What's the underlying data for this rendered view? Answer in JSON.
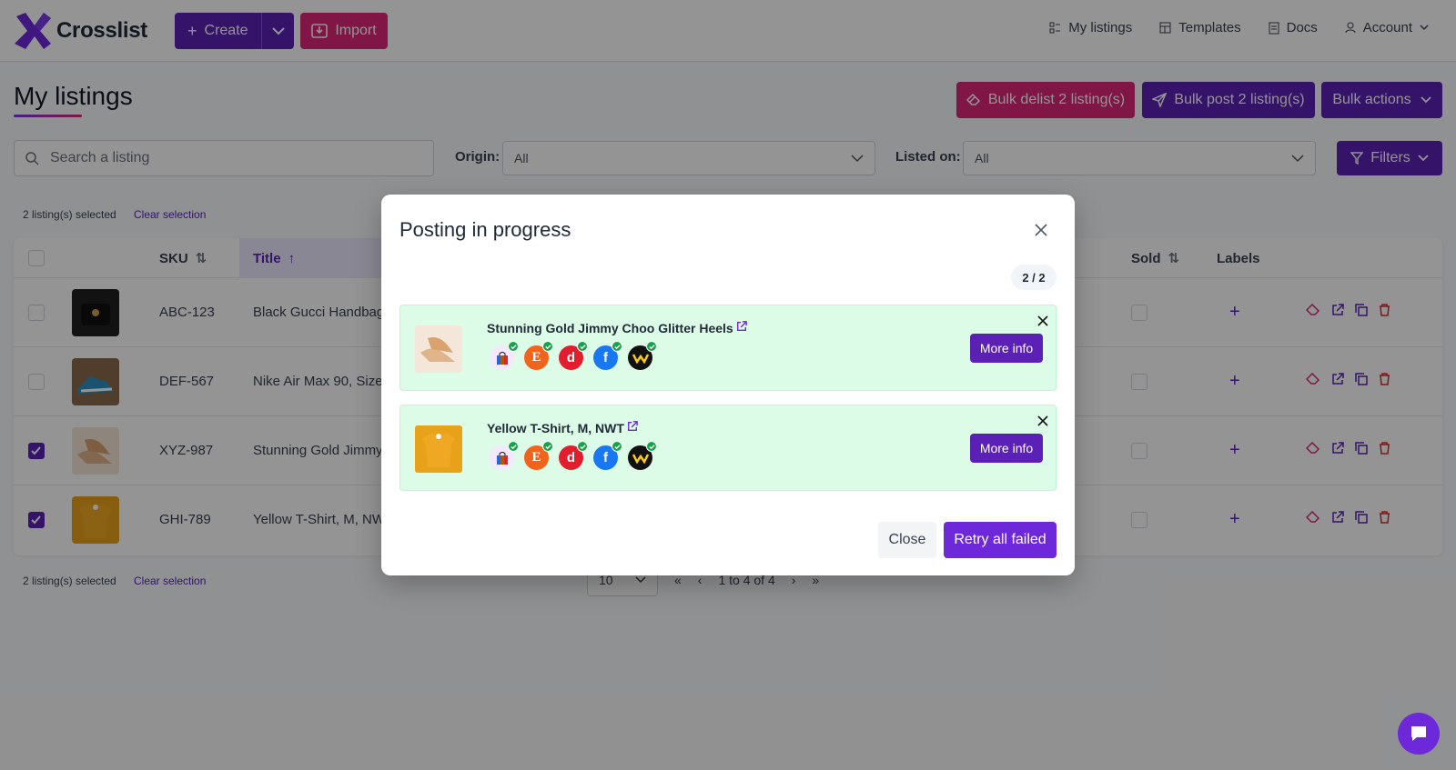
{
  "app": {
    "name": "Crosslist",
    "brand_color": "#5b21b6",
    "accent_color": "#db2777"
  },
  "topbar": {
    "create_label": "Create",
    "import_label": "Import",
    "nav": [
      {
        "label": "My listings",
        "icon": "list-icon"
      },
      {
        "label": "Templates",
        "icon": "template-icon"
      },
      {
        "label": "Docs",
        "icon": "docs-icon"
      },
      {
        "label": "Account",
        "icon": "user-icon"
      }
    ]
  },
  "page": {
    "title": "My listings",
    "bulk_delist_label": "Bulk delist 2 listing(s)",
    "bulk_post_label": "Bulk post 2 listing(s)",
    "bulk_actions_label": "Bulk actions"
  },
  "filters": {
    "search_placeholder": "Search a listing",
    "origin_label": "Origin:",
    "origin_value": "All",
    "listed_on_label": "Listed on:",
    "listed_on_value": "All",
    "filters_label": "Filters"
  },
  "selection": {
    "info": "2 listing(s) selected",
    "clear": "Clear selection"
  },
  "table": {
    "headers": {
      "sku": "SKU",
      "title": "Title",
      "sold": "Sold",
      "labels": "Labels"
    },
    "rows": [
      {
        "sku": "ABC-123",
        "title": "Black Gucci Handbag",
        "checked": false
      },
      {
        "sku": "DEF-567",
        "title": "Nike Air Max 90, Size",
        "checked": false
      },
      {
        "sku": "XYZ-987",
        "title": "Stunning Gold Jimmy",
        "checked": true
      },
      {
        "sku": "GHI-789",
        "title": "Yellow T-Shirt, M, NW",
        "checked": true
      }
    ]
  },
  "pagination": {
    "page_size": "10",
    "range": "1 to 4 of 4"
  },
  "modal": {
    "title": "Posting in progress",
    "progress": "2 / 2",
    "items": [
      {
        "title": "Stunning Gold Jimmy Choo Glitter Heels",
        "more_info": "More info"
      },
      {
        "title": "Yellow T-Shirt, M, NWT",
        "more_info": "More info"
      }
    ],
    "close_label": "Close",
    "retry_label": "Retry all failed"
  }
}
